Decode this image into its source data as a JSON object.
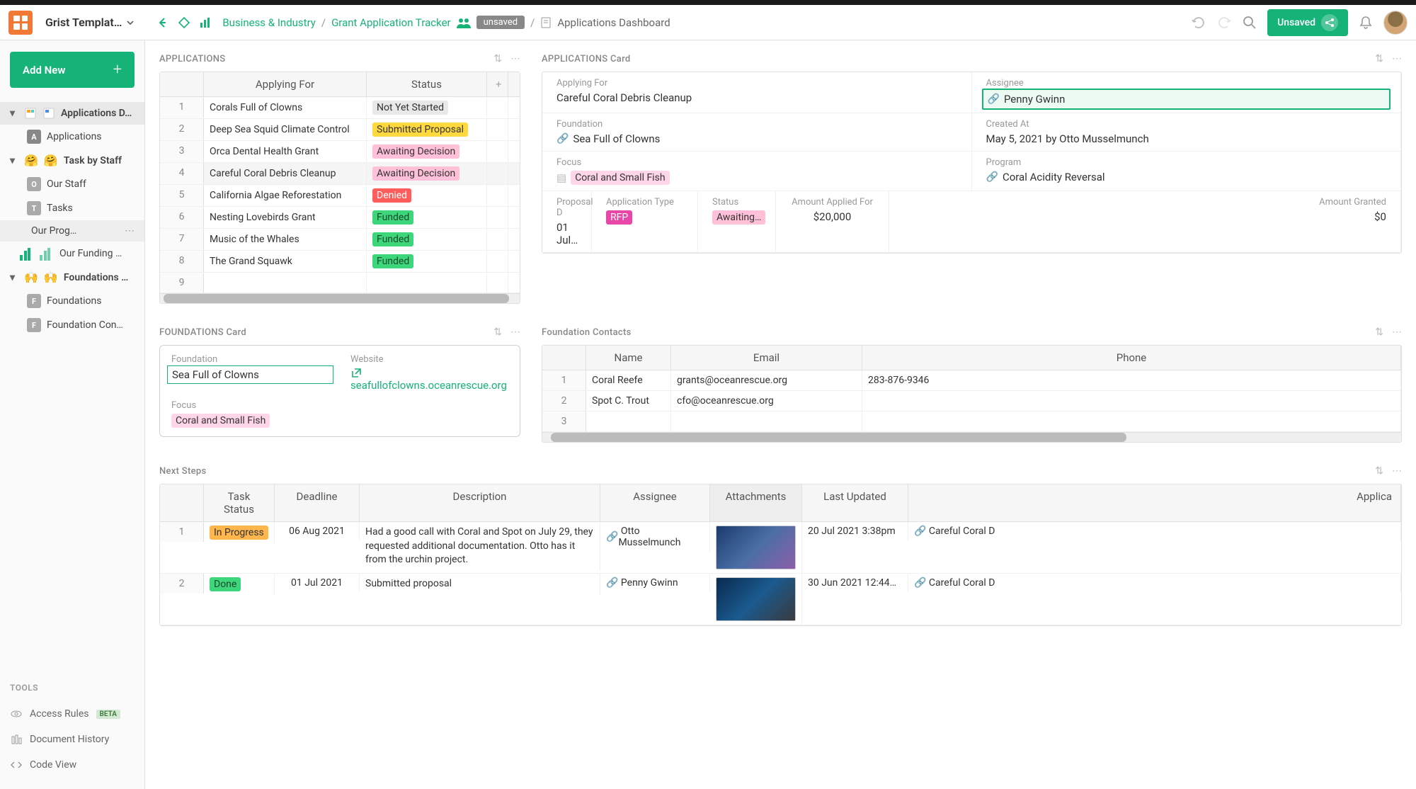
{
  "header": {
    "workspace": "Grist Templat…",
    "breadcrumb_workspace": "Business & Industry",
    "breadcrumb_doc": "Grant Application Tracker",
    "unsaved_badge": "unsaved",
    "breadcrumb_page": "Applications Dashboard",
    "unsaved_btn": "Unsaved"
  },
  "sidebar": {
    "add_new": "Add New",
    "items": [
      {
        "label": "Applications D…"
      },
      {
        "label": "Applications"
      },
      {
        "label": "Task by Staff"
      },
      {
        "label": "Our Staff"
      },
      {
        "label": "Tasks"
      },
      {
        "label": "Our Prog…"
      },
      {
        "label": "Our Funding …"
      },
      {
        "label": "Foundations …"
      },
      {
        "label": "Foundations"
      },
      {
        "label": "Foundation Con…"
      }
    ],
    "tools_label": "TOOLS",
    "tools": [
      {
        "label": "Access Rules",
        "beta": "BETA"
      },
      {
        "label": "Document History"
      },
      {
        "label": "Code View"
      }
    ]
  },
  "applications": {
    "title": "APPLICATIONS",
    "cols": [
      "Applying For",
      "Status"
    ],
    "rows": [
      {
        "n": "1",
        "applying": "Corals Full of Clowns",
        "status": "Not Yet Started",
        "cls": "tag-gray"
      },
      {
        "n": "2",
        "applying": "Deep Sea Squid Climate Control",
        "status": "Submitted Proposal",
        "cls": "tag-yellow"
      },
      {
        "n": "3",
        "applying": "Orca Dental Health Grant",
        "status": "Awaiting Decision",
        "cls": "tag-pink"
      },
      {
        "n": "4",
        "applying": "Careful Coral Debris Cleanup",
        "status": "Awaiting Decision",
        "cls": "tag-pink"
      },
      {
        "n": "5",
        "applying": "California Algae Reforestation",
        "status": "Denied",
        "cls": "tag-red"
      },
      {
        "n": "6",
        "applying": "Nesting Lovebirds Grant",
        "status": "Funded",
        "cls": "tag-green"
      },
      {
        "n": "7",
        "applying": "Music of the Whales",
        "status": "Funded",
        "cls": "tag-green"
      },
      {
        "n": "8",
        "applying": "The Grand Squawk",
        "status": "Funded",
        "cls": "tag-green"
      },
      {
        "n": "9",
        "applying": "",
        "status": "",
        "cls": ""
      }
    ]
  },
  "app_card": {
    "title": "APPLICATIONS Card",
    "fields": {
      "applying_for_label": "Applying For",
      "applying_for": "Careful Coral Debris Cleanup",
      "assignee_label": "Assignee",
      "assignee": "Penny Gwinn",
      "foundation_label": "Foundation",
      "foundation": "Sea Full of Clowns",
      "created_label": "Created At",
      "created": "May 5, 2021 by Otto Musselmunch",
      "focus_label": "Focus",
      "focus": "Coral and Small Fish",
      "program_label": "Program",
      "program": "Coral Acidity Reversal",
      "prop_d_label": "Proposal D",
      "prop_d": "01 Jul…",
      "app_type_label": "Application Type",
      "app_type": "RFP",
      "status_label": "Status",
      "status": "Awaiting…",
      "amount_applied_label": "Amount Applied For",
      "amount_applied": "$20,000",
      "amount_granted_label": "Amount Granted",
      "amount_granted": "$0"
    }
  },
  "foundations_card": {
    "title": "FOUNDATIONS Card",
    "foundation_label": "Foundation",
    "foundation": "Sea Full of Clowns",
    "website_label": "Website",
    "website": "seafullofclowns.oceanrescue.org",
    "focus_label": "Focus",
    "focus": "Coral and Small Fish"
  },
  "contacts": {
    "title": "Foundation Contacts",
    "cols": [
      "Name",
      "Email",
      "Phone"
    ],
    "rows": [
      {
        "n": "1",
        "name": "Coral Reefe",
        "email": "grants@oceanrescue.org",
        "phone": "283-876-9346"
      },
      {
        "n": "2",
        "name": "Spot C. Trout",
        "email": "cfo@oceanrescue.org",
        "phone": ""
      },
      {
        "n": "3",
        "name": "",
        "email": "",
        "phone": ""
      }
    ]
  },
  "next_steps": {
    "title": "Next Steps",
    "cols": [
      "Task Status",
      "Deadline",
      "Description",
      "Assignee",
      "Attachments",
      "Last Updated",
      "Applica"
    ],
    "rows": [
      {
        "n": "1",
        "status": "In Progress",
        "scls": "tag-orange",
        "deadline": "06 Aug 2021",
        "desc": "Had a good call with Coral and Spot on July 29, they requested additional documentation. Otto has it from the urchin project.",
        "assignee": "Otto Musselmunch",
        "updated": "20 Jul 2021 3:38pm",
        "app": "Careful Coral D"
      },
      {
        "n": "2",
        "status": "Done",
        "scls": "tag-green",
        "deadline": "01 Jul 2021",
        "desc": "Submitted proposal",
        "assignee": "Penny Gwinn",
        "updated": "30 Jun 2021 12:44…",
        "app": "Careful Coral D"
      }
    ]
  }
}
